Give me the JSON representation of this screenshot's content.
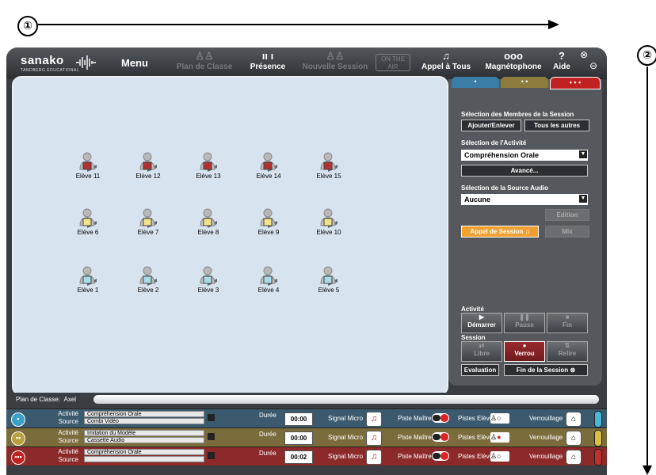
{
  "annotations": {
    "top_marker": "①",
    "right_marker": "②"
  },
  "brand": {
    "name": "sanako",
    "sub": "TANDBERG EDUCATIONAL"
  },
  "toolbar": {
    "menu": "Menu",
    "items": [
      {
        "label": "Plan de Classe",
        "icon": "seating-plan-icon",
        "enabled": false
      },
      {
        "label": "Présence",
        "icon": "attendance-icon",
        "enabled": true
      },
      {
        "label": "Nouvelle Session",
        "icon": "new-session-icon",
        "enabled": false
      },
      {
        "label": "Appel à Tous",
        "icon": "call-all-icon",
        "enabled": true
      },
      {
        "label": "Magnétophone",
        "icon": "tape-recorder-icon",
        "enabled": true
      },
      {
        "label": "Aide",
        "icon": "help-icon",
        "enabled": true
      }
    ],
    "on_air": "ON THE AIR"
  },
  "students": [
    {
      "name": "Elève 11",
      "color": "#b33030"
    },
    {
      "name": "Elève 12",
      "color": "#b33030"
    },
    {
      "name": "Elève 13",
      "color": "#b33030"
    },
    {
      "name": "Elève 14",
      "color": "#b33030"
    },
    {
      "name": "Elève 15",
      "color": "#b33030"
    },
    {
      "name": "Elève 6",
      "color": "#f2e48a"
    },
    {
      "name": "Elève 7",
      "color": "#f2e48a"
    },
    {
      "name": "Elève 8",
      "color": "#f2e48a"
    },
    {
      "name": "Elève 9",
      "color": "#f2e48a"
    },
    {
      "name": "Elève 10",
      "color": "#f2e48a"
    },
    {
      "name": "Elève 1",
      "color": "#a9dbe8"
    },
    {
      "name": "Elève 2",
      "color": "#a9dbe8"
    },
    {
      "name": "Elève 3",
      "color": "#a9dbe8"
    },
    {
      "name": "Elève 4",
      "color": "#a9dbe8"
    },
    {
      "name": "Elève 5",
      "color": "#a9dbe8"
    }
  ],
  "panel": {
    "tabs": [
      "•",
      "• •",
      "• • •"
    ],
    "members_label": "Sélection des Membres de la Session",
    "add_remove": "Ajouter/Enlever",
    "all_others": "Tous les autres",
    "activity_label": "Sélection de l'Activité",
    "activity_value": "Compréhension Orale",
    "advanced": "Avancé...",
    "audio_label": "Sélection de la Source Audio",
    "audio_value": "Aucune",
    "edition": "Edition",
    "session_call": "Appel de Session",
    "mix": "Mix",
    "activite": "Activité",
    "start": "Démarrer",
    "pause": "Pause",
    "end": "Fin",
    "session": "Session",
    "free": "Libre",
    "lock": "Verrou",
    "collect": "Relire",
    "evaluation": "Evaluation",
    "end_session": "Fin de la Session"
  },
  "classbar": {
    "label": "Plan de Classe:",
    "value": "Axel"
  },
  "sessions": [
    {
      "dots": "•",
      "color": "#3aa0c8",
      "bg": "#3c5a6e",
      "activity": "Compréhension Orale",
      "source": "Combi Vidéo",
      "duration": "00:00",
      "pistes": "green-half",
      "cap": "#48b8d8"
    },
    {
      "dots": "••",
      "color": "#b8a040",
      "bg": "#7b6c3c",
      "activity": "Imitation du Modèle",
      "source": "Cassette Audio",
      "duration": "00:00",
      "pistes": "red",
      "cap": "#d8c040"
    },
    {
      "dots": "•••",
      "color": "#c02020",
      "bg": "#8c2a2a",
      "activity": "Compréhension Orale",
      "source": "",
      "duration": "00:02",
      "pistes": "half",
      "cap": "#c03030"
    }
  ],
  "row_labels": {
    "activite": "Activité",
    "source": "Source",
    "duree": "Durée",
    "signal": "Signal Micro",
    "piste_maitre": "Piste Maître",
    "pistes_eleves": "Pistes Elèves",
    "verrouillage": "Verrouillage"
  }
}
